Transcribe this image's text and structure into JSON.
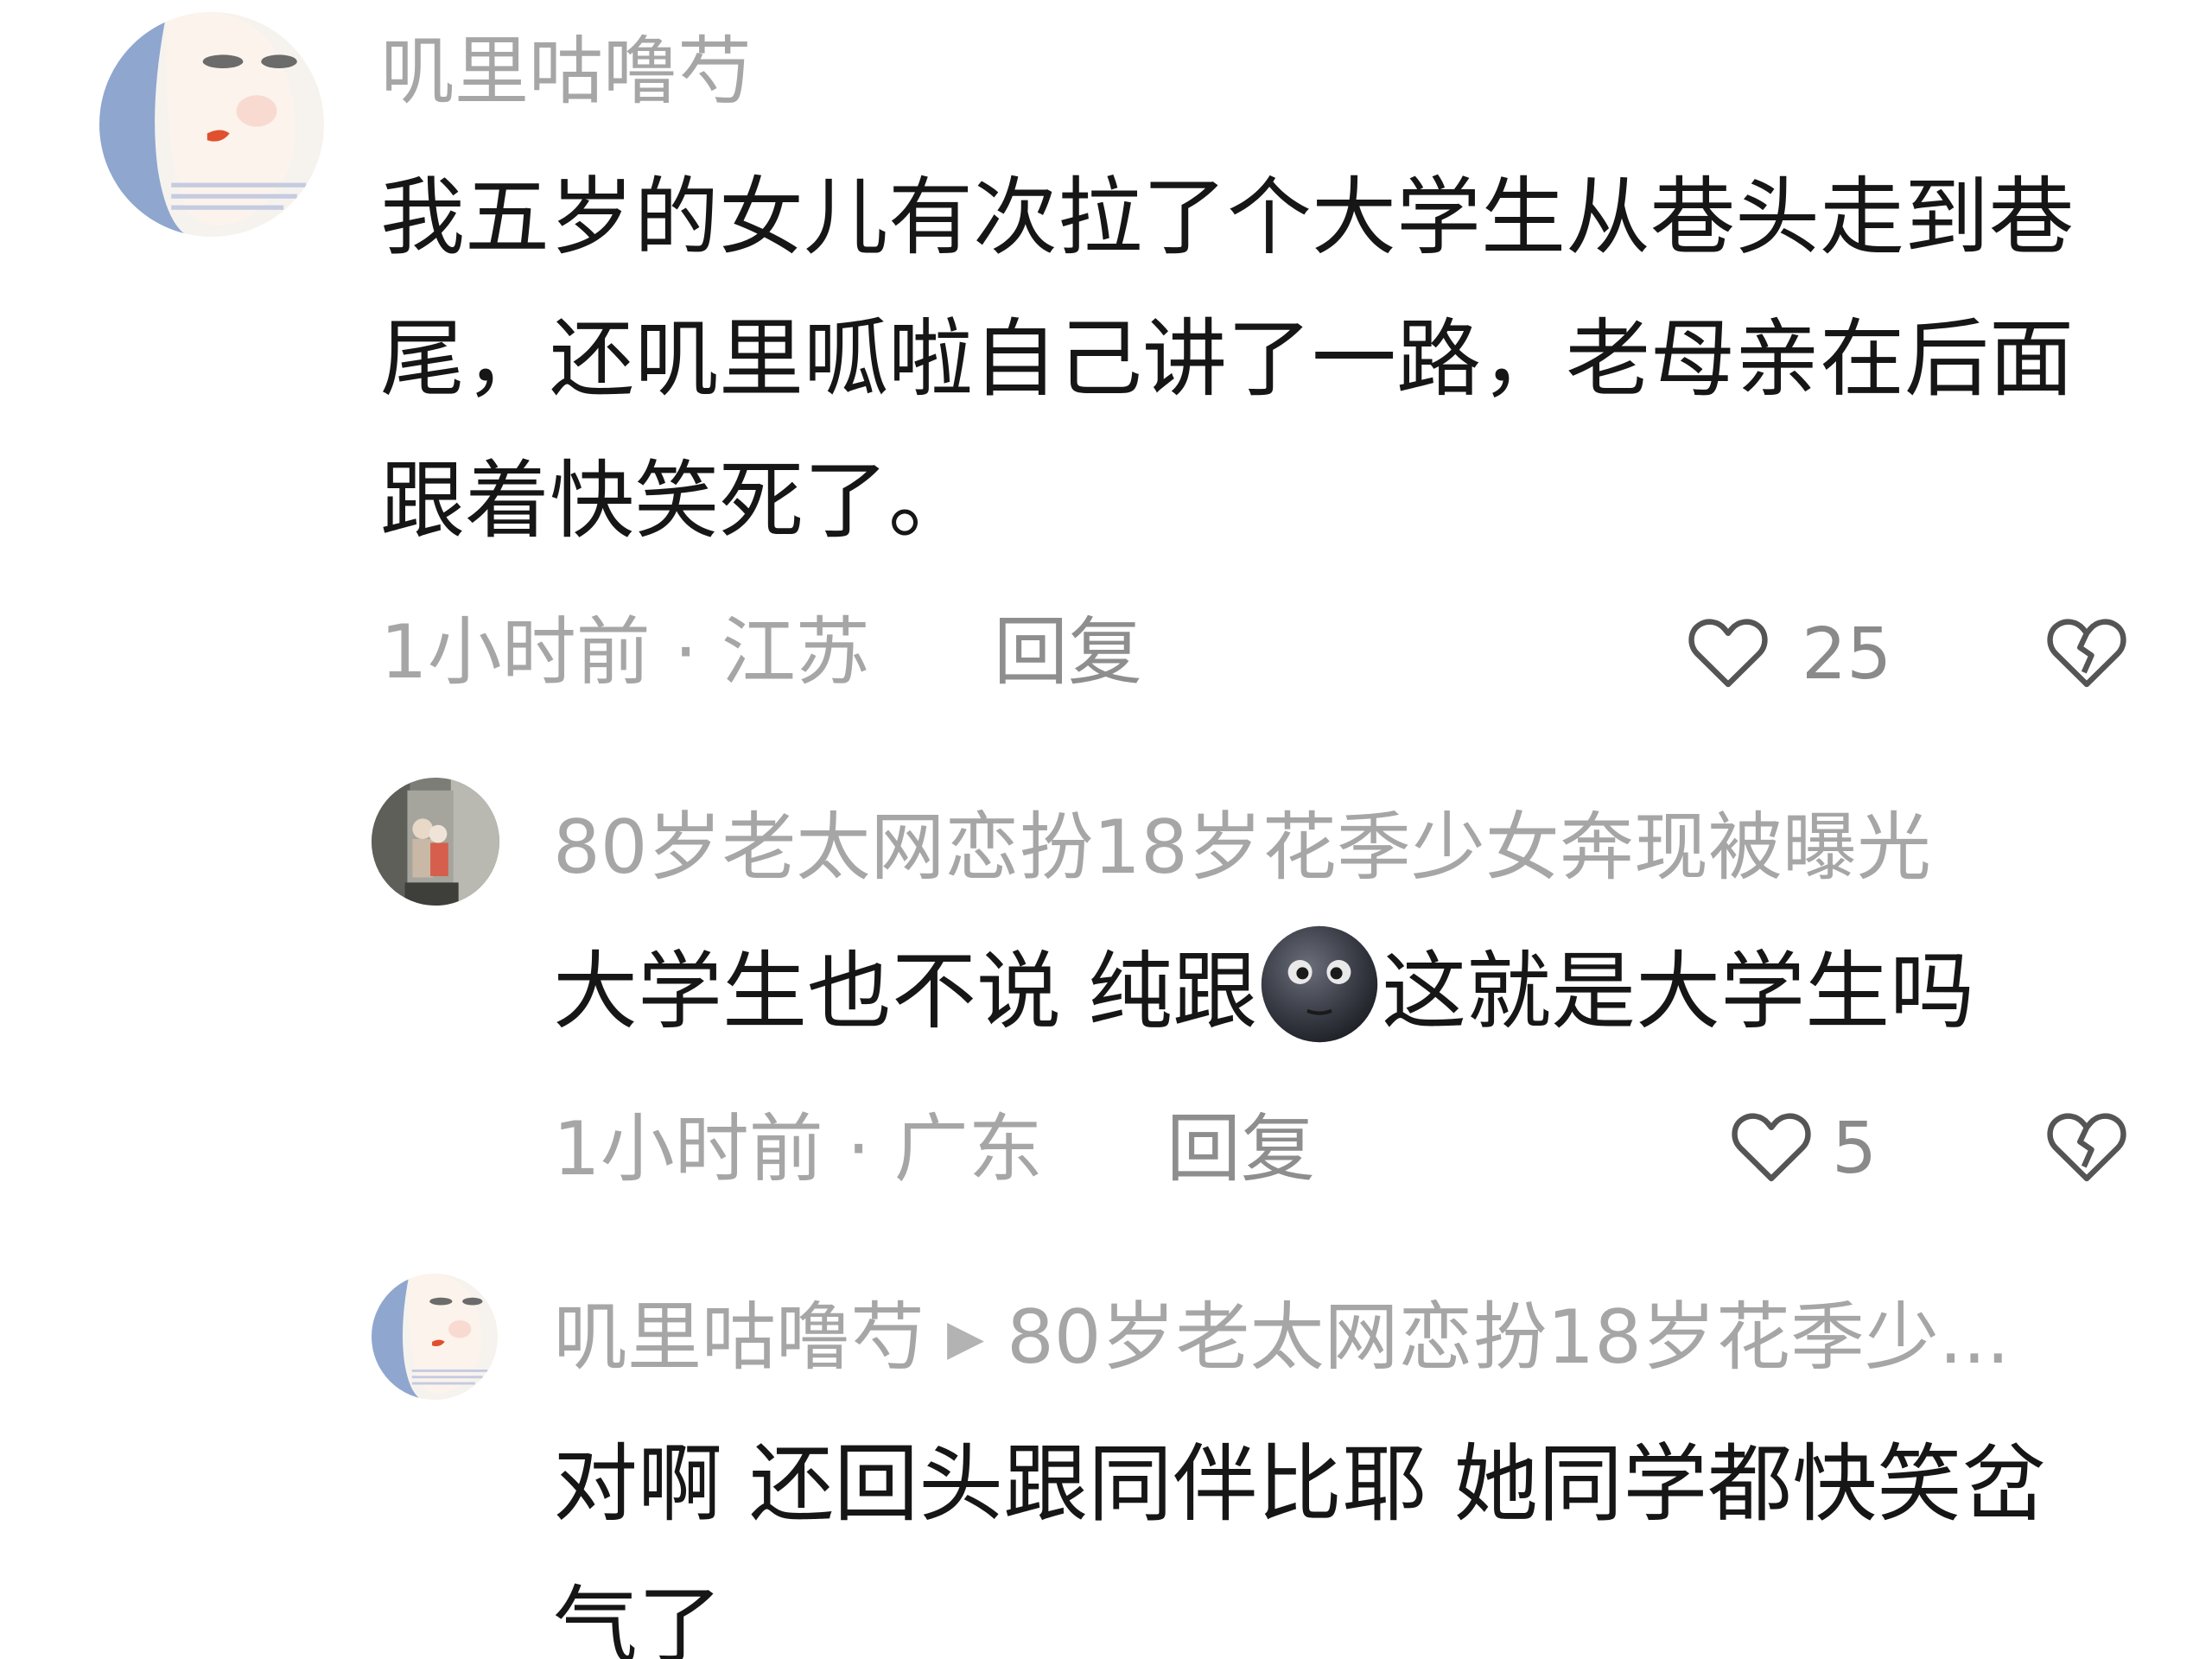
{
  "comments": [
    {
      "username": "叽里咕噜芍",
      "text": "我五岁的女儿有次拉了个大学生从巷头走到巷尾，还叽里呱啦自己讲了一路，老母亲在后面跟着快笑死了。",
      "time_location": "1小时前 · 江苏",
      "reply_label": "回复",
      "like_count": "25",
      "avatar_icon": "illustrated-face-avatar",
      "replies": [
        {
          "username": "80岁老太网恋扮18岁花季少女奔现被曝光",
          "text_before_emoji": "大学生也不说 纯跟",
          "emoji": "new-moon-face-emoji",
          "text_after_emoji": "这就是大学生吗",
          "time_location": "1小时前 · 广东",
          "reply_label": "回复",
          "like_count": "5",
          "avatar_icon": "photo-avatar"
        },
        {
          "username": "叽里咕噜芍",
          "reply_to": "80岁老太网恋扮18岁花季少...",
          "text": "对啊 还回头跟同伴比耶 她同学都快笑岔气了",
          "avatar_icon": "illustrated-face-avatar"
        }
      ]
    }
  ],
  "icons": {
    "like": "heart-outline-icon",
    "dislike": "broken-heart-icon",
    "reply_arrow": "play-arrow-icon"
  },
  "colors": {
    "username": "#a6a6a6",
    "body": "#161616",
    "meta": "#a6a6a6",
    "icon": "#555555"
  }
}
